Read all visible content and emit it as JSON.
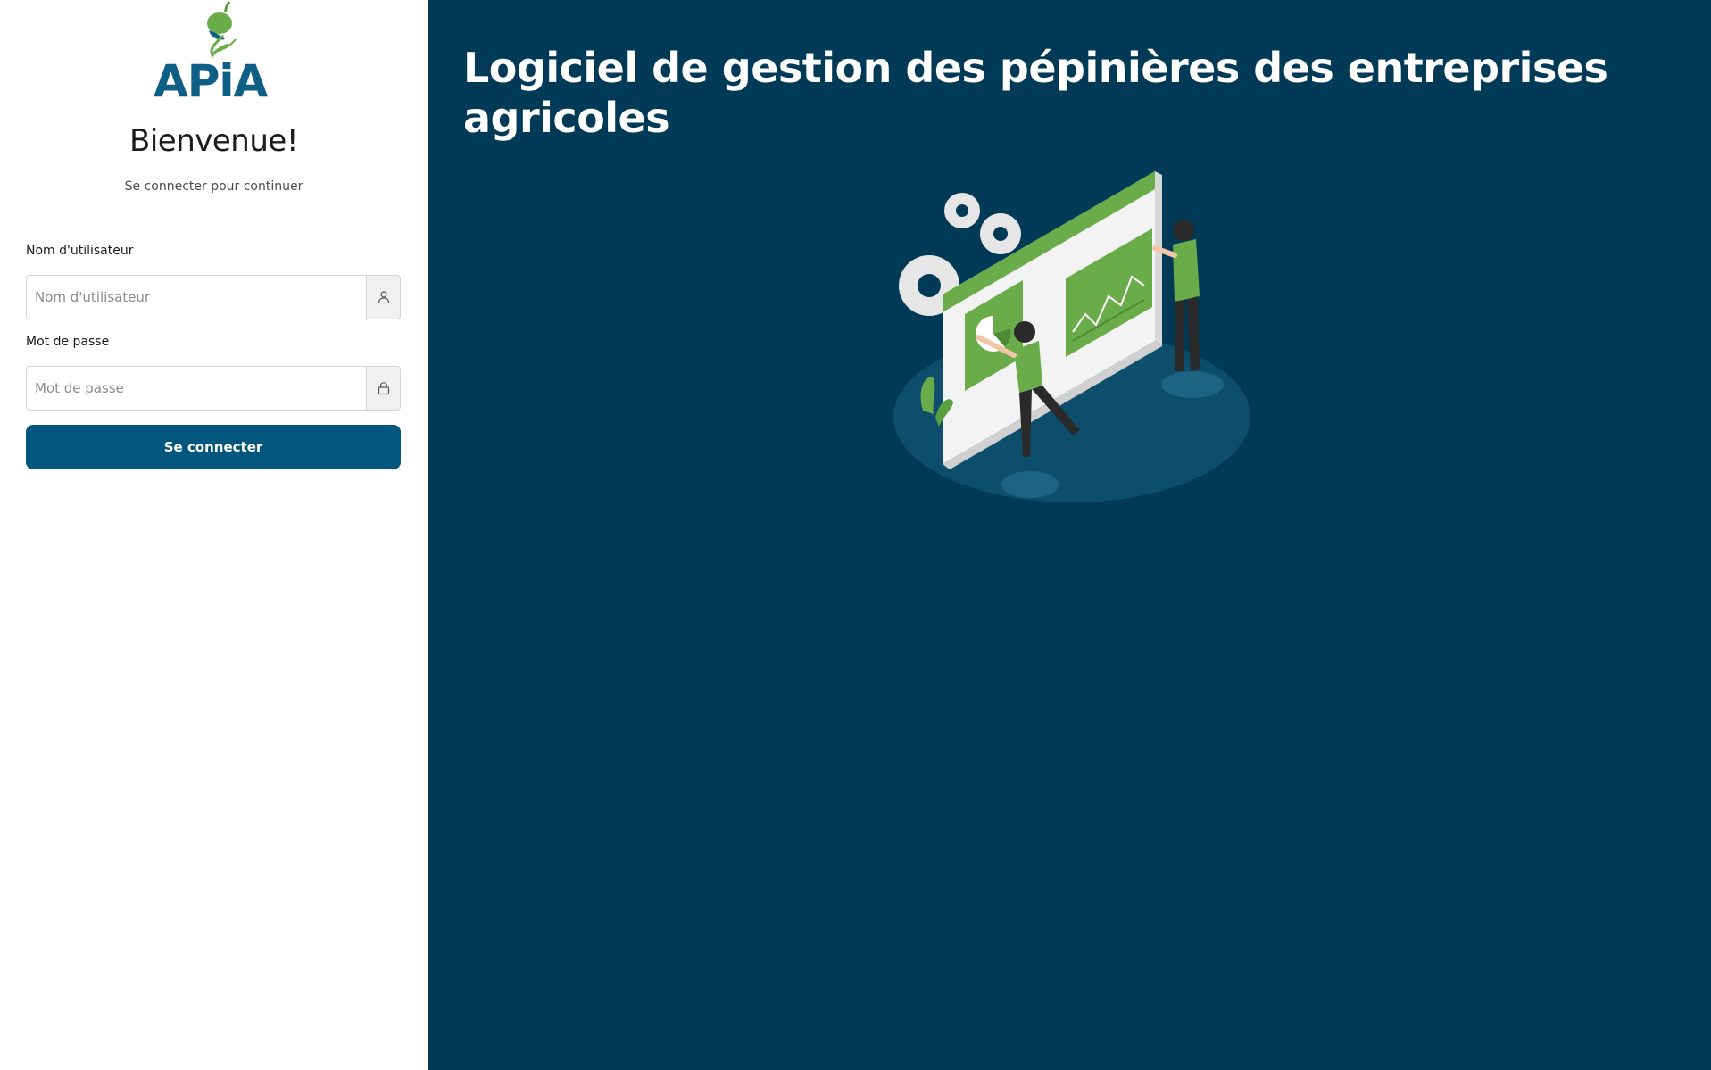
{
  "brand": {
    "logo_text": "APiA",
    "colors": {
      "primary": "#03577f",
      "panel_bg": "#013a57",
      "accent_green": "#6aac4a"
    }
  },
  "login": {
    "welcome": "Bienvenue!",
    "subtitle": "Se connecter pour continuer",
    "username": {
      "label": "Nom d'utilisateur",
      "placeholder": "Nom d'utilisateur",
      "value": "",
      "icon": "user-icon"
    },
    "password": {
      "label": "Mot de passe",
      "placeholder": "Mot de passe",
      "value": "",
      "icon": "lock-icon"
    },
    "submit_label": "Se connecter"
  },
  "hero": {
    "headline": "Logiciel de gestion des pépinières des entreprises agricoles"
  }
}
